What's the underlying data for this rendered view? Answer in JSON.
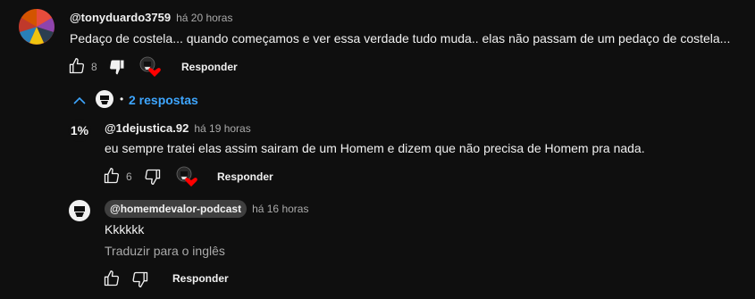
{
  "comment": {
    "author": "@tonyduardo3759",
    "time": "há 20 horas",
    "text": "Pedaço de costela... quando começamos e ver essa verdade tudo muda.. elas não passam de um pedaço de costela...",
    "likes": "8",
    "reply_label": "Responder",
    "replies_toggle": "2 respostas"
  },
  "replies": [
    {
      "avatar_text": "1%",
      "author": "@1dejustica.92",
      "time": "há 19 horas",
      "text": "eu sempre tratei elas assim sairam de um Homem e dizem que não precisa de Homem pra nada.",
      "likes": "6",
      "reply_label": "Responder"
    },
    {
      "author": "@homemdevalor-podcast",
      "time": "há 16 horas",
      "text": "Kkkkkk",
      "translate": "Traduzir para o inglês",
      "reply_label": "Responder"
    }
  ],
  "colors": {
    "background": "#0f0f0f",
    "link": "#3ea6ff",
    "heart": "#ff0000",
    "muted": "#aaaaaa"
  }
}
